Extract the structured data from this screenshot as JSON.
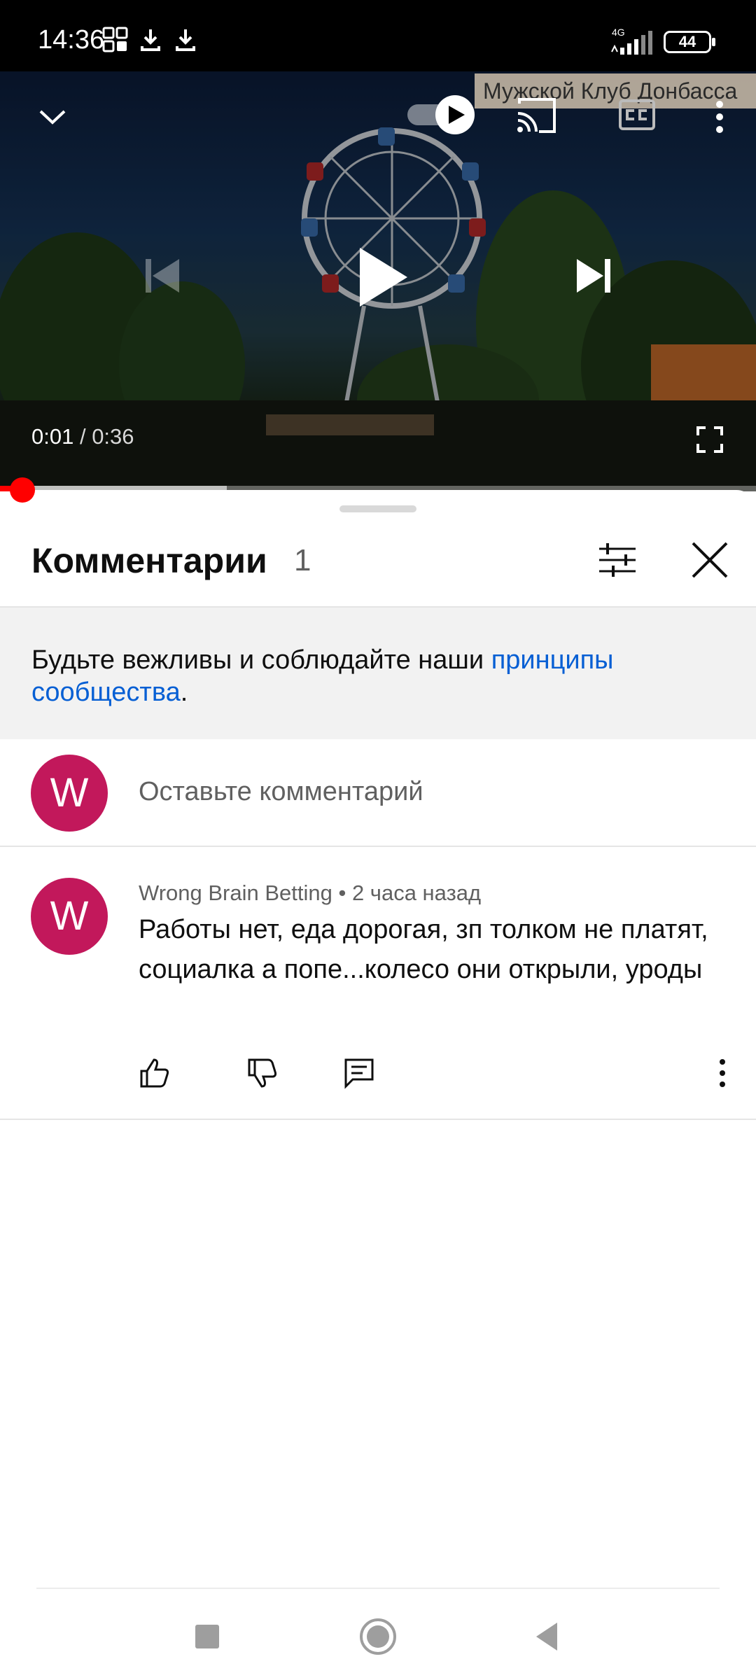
{
  "status_bar": {
    "time": "14:36",
    "network": "4G",
    "battery": "44"
  },
  "video": {
    "watermark": "Мужской Клуб Донбасса",
    "current_time": "0:01",
    "separator": " / ",
    "duration": "0:36",
    "played_fraction": 0.03,
    "buffered_fraction": 0.3
  },
  "comments_panel": {
    "title": "Комментарии",
    "count": "1",
    "notice_text": "Будьте вежливы и соблюдайте наши ",
    "notice_link": "принципы сообщества",
    "notice_end": ".",
    "compose_placeholder": "Оставьте комментарий",
    "user_avatar_letter": "W"
  },
  "comments": [
    {
      "avatar_letter": "W",
      "author": "Wrong Brain Betting",
      "time_ago": "2 часа назад",
      "meta_sep": " • ",
      "text": "Работы нет, еда дорогая, зп толком не платят, социалка а попе...колесо они открыли, уроды"
    }
  ],
  "colors": {
    "avatar": "#c2185b",
    "link": "#065fd4",
    "progress": "#ff0000"
  }
}
